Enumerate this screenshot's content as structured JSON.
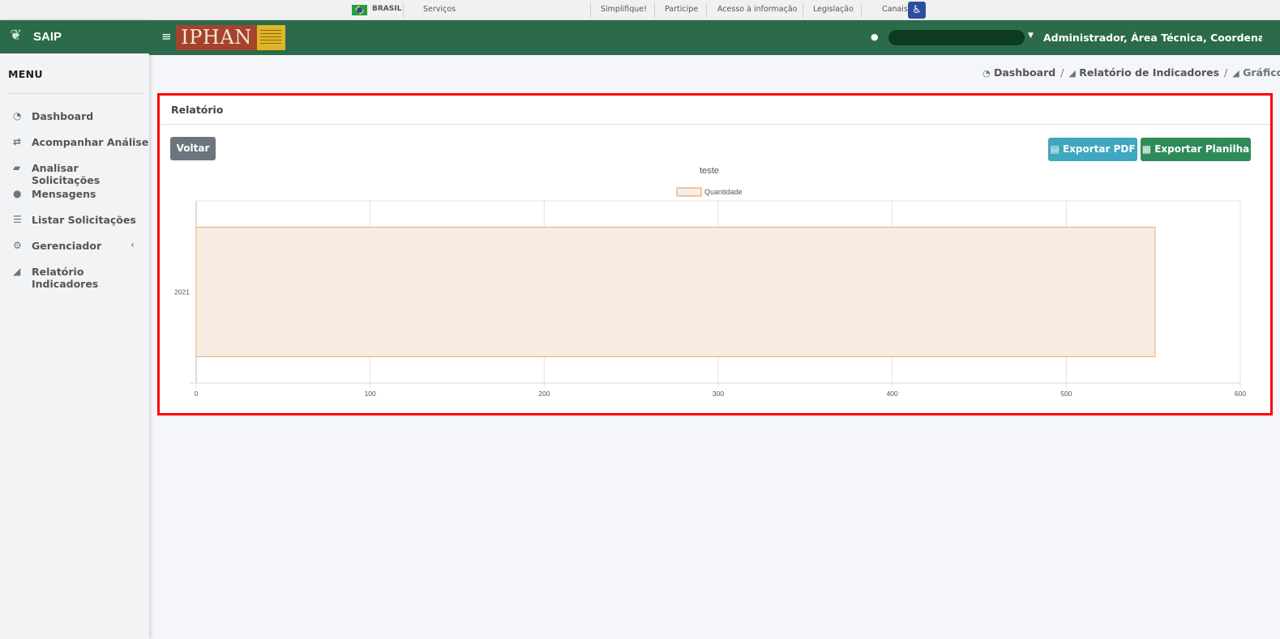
{
  "gov_bar": {
    "country": "BRASIL",
    "links": [
      "Serviços",
      "Simplifique!",
      "Participe",
      "Acesso à informação",
      "Legislação",
      "Canais"
    ]
  },
  "brand": {
    "name": "SAIP"
  },
  "header": {
    "logo_text": "IPHAN",
    "user_role": "Administrador, Área Técnica, Coordenação..."
  },
  "menu": {
    "title": "MENU",
    "items": [
      {
        "label": "Dashboard",
        "icon": "dashboard-icon"
      },
      {
        "label": "Acompanhar Análise",
        "icon": "exchange-icon"
      },
      {
        "label": "Analisar Solicitações",
        "icon": "book-icon"
      },
      {
        "label": "Mensagens",
        "icon": "comments-icon"
      },
      {
        "label": "Listar Solicitações",
        "icon": "list-icon"
      },
      {
        "label": "Gerenciador",
        "icon": "cogs-icon"
      },
      {
        "label": "Relatório Indicadores",
        "icon": "area-chart-icon"
      }
    ]
  },
  "breadcrumb": [
    {
      "label": "Dashboard"
    },
    {
      "label": "Relatório de Indicadores"
    },
    {
      "label": "Gráfico"
    }
  ],
  "card": {
    "title": "Relatório",
    "back_label": "Voltar",
    "export_pdf_label": "Exportar PDF",
    "export_sheet_label": "Exportar Planilha"
  },
  "colors": {
    "primary_green": "#2b6a4a",
    "info": "#3fa7bf",
    "success": "#2f8a5a",
    "bar_fill": "#f8ede3",
    "bar_stroke": "#f0b48a",
    "highlight": "#ff0000"
  },
  "chart_data": {
    "type": "bar",
    "orientation": "horizontal",
    "title": "teste",
    "categories": [
      "2021"
    ],
    "series": [
      {
        "name": "Quantidade",
        "values": [
          551
        ]
      }
    ],
    "xlim": [
      0,
      600
    ],
    "x_ticks": [
      0,
      100,
      200,
      300,
      400,
      500,
      600
    ],
    "legend_position": "top",
    "grid": true
  }
}
